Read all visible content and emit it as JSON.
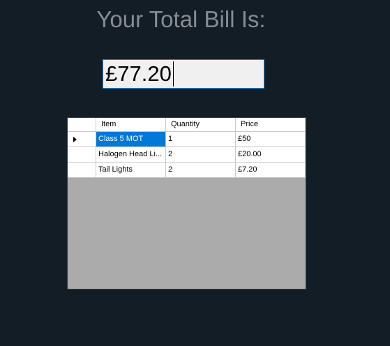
{
  "heading": "Your Total Bill Is:",
  "total": {
    "value": "£77.20"
  },
  "grid": {
    "columns": [
      "Item",
      "Quantity",
      "Price"
    ],
    "rows": [
      {
        "item": "Class 5 MOT",
        "quantity": "1",
        "price": "£50"
      },
      {
        "item": "Halogen Head Li...",
        "quantity": "2",
        "price": "£20.00"
      },
      {
        "item": "Tail Lights",
        "quantity": "2",
        "price": "£7.20"
      }
    ],
    "selected_row": 0
  },
  "colors": {
    "background": "#121d26",
    "heading": "#878c91",
    "selection": "#0078d7",
    "grid_empty": "#ababab",
    "input_border": "#2d8bd8"
  },
  "icons": {
    "row_selector": "triangle-right-icon"
  }
}
